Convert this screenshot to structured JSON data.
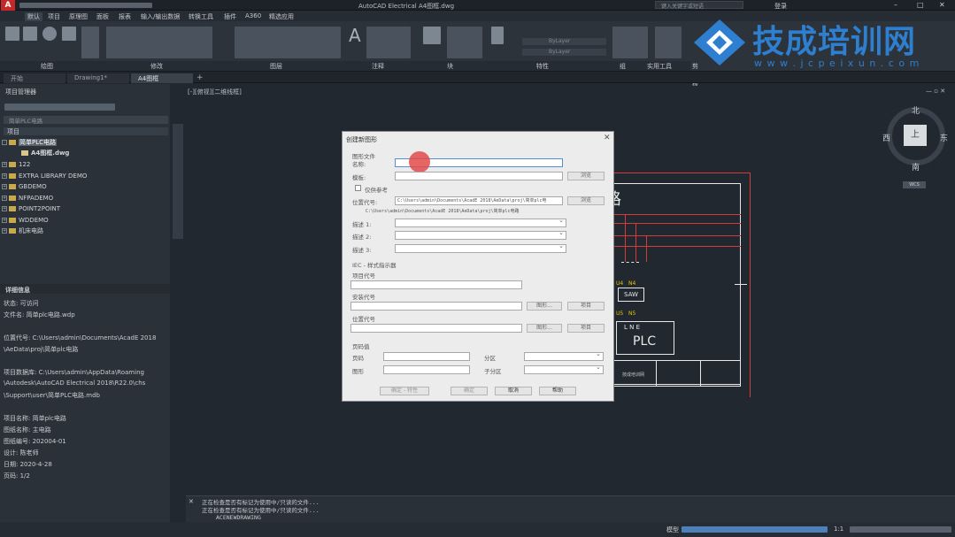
{
  "window": {
    "title": "AutoCAD Electrical  A4图框.dwg",
    "search_placeholder": "键入关键字或短语",
    "login": "登录"
  },
  "menu": [
    "默认",
    "项目",
    "原理图",
    "面板",
    "报表",
    "输入/输出数据",
    "转换工具",
    "插件",
    "A360",
    "精选应用"
  ],
  "ribbon_groups": [
    "绘图",
    "修改",
    "图层",
    "注释",
    "块",
    "特性",
    "组",
    "实用工具",
    "剪贴板"
  ],
  "ribbon_labels": {
    "bylayer1": "ByLayer",
    "bylayer2": "ByLayer"
  },
  "doc_tabs": [
    "开始",
    "Drawing1*",
    "A4图框"
  ],
  "project_manager": {
    "title": "项目管理器",
    "dropdown": "简单PLC电路",
    "tree_header": "项目",
    "active_project": "简单PLC电路",
    "active_drawing": "A4图框.dwg",
    "projects": [
      "122",
      "EXTRA LIBRARY DEMO",
      "GBDEMO",
      "NFPADEMO",
      "POINT2POINT",
      "WDDEMO",
      "机床电路"
    ]
  },
  "details": {
    "title": "详细信息",
    "lines": [
      "状态: 可访问",
      "文件名: 简单plc电路.wdp",
      "",
      "位置代号: C:\\Users\\admin\\Documents\\AcadE 2018",
      "\\AeData\\proj\\简单plc电路",
      "",
      "项目数据库: C:\\Users\\admin\\AppData\\Roaming",
      "\\Autodesk\\AutoCAD Electrical 2018\\R22.0\\chs",
      "\\Support\\user\\简单PLC电路.mdb",
      "",
      "项目名称: 简单plc电路",
      "图纸名称: 主电路",
      "图纸编号: 202004-01",
      "设计: 陈老师",
      "日期: 2020-4-28",
      "页码: 1/2"
    ]
  },
  "canvas": {
    "view_label": "[-][俯视][二维线框]",
    "compass": {
      "n": "北",
      "s": "南",
      "e": "东",
      "w": "西",
      "center": "上",
      "wcs": "WCS"
    },
    "drawing": {
      "title_char": "路",
      "saw": "SAW",
      "plc": "PLC",
      "plc_pins": "L  N  E",
      "u4": "U4",
      "n4": "N4",
      "u5": "U5",
      "n5": "N5",
      "logo_text": "技成培训网"
    }
  },
  "watermark": {
    "name": "技成培训网",
    "url": "w w w . j c p e i x u n . c o m"
  },
  "dialog": {
    "title": "创建新图形",
    "section_file": "图形文件",
    "name_label": "名称:",
    "template_label": "模板:",
    "browse1": "浏览",
    "ref_label": "仅供参考",
    "location_label": "位置代号:",
    "location_value": "C:\\Users\\admin\\Documents\\AcadE 2018\\AeData\\proj\\简单plc电",
    "location_sub": "C:\\Users\\admin\\Documents\\AcadE 2018\\AeData\\proj\\简单plc电路",
    "browse2": "浏览",
    "desc1": "描述 1:",
    "desc2": "描述 2:",
    "desc3": "描述 3:",
    "iec_label": "IEC - 样式指示器",
    "proj_code": "项目代号",
    "install_code": "安装代号",
    "location_code": "位置代号",
    "drawing_btn": "图形...",
    "project_btn": "项目",
    "page_section": "页码值",
    "page": "页码",
    "drawing": "图形",
    "section": "分区",
    "subsection": "子分区",
    "btn_ok_props": "确定 - 特性",
    "btn_ok": "确定",
    "btn_cancel": "取消",
    "btn_help": "帮助"
  },
  "command": {
    "line1": "正在检查是否有标记为使用中/只读的文件...",
    "line2": "正在检查是否有标记为使用中/只读的文件...",
    "prompt": "ACENEWDRAWING"
  },
  "status": {
    "model": "模型",
    "scale": "1:1"
  }
}
